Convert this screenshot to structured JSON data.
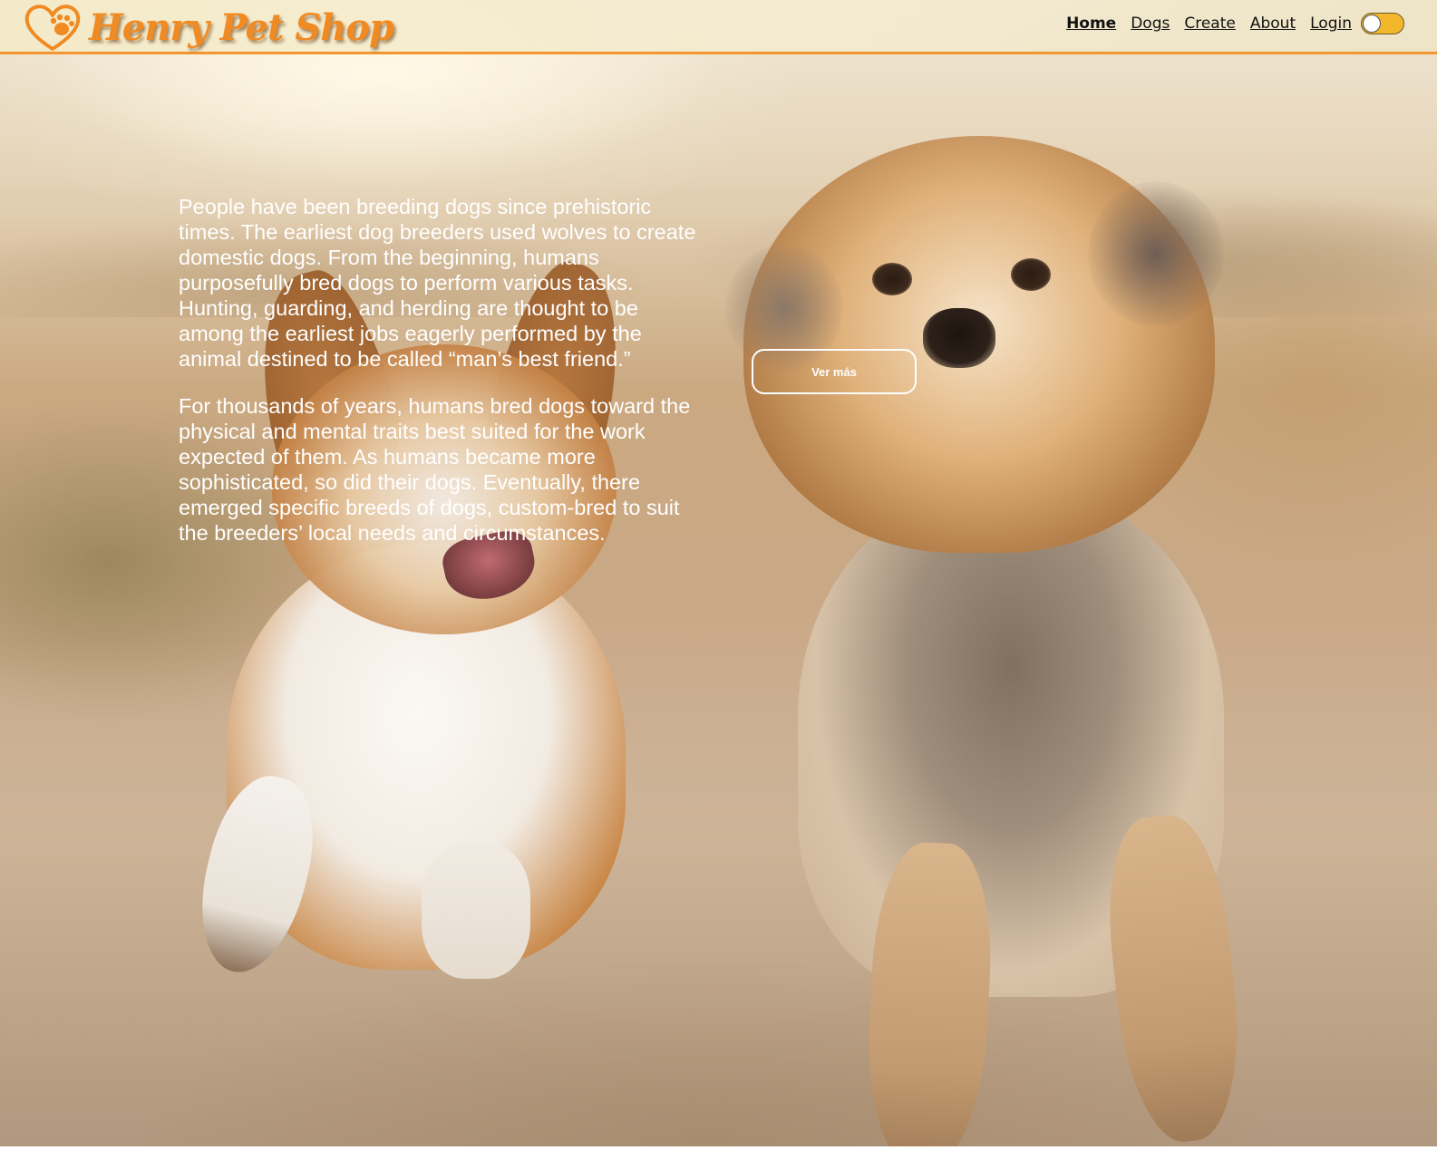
{
  "brand": {
    "name": "Henry Pet Shop",
    "logo_icon": "heart-paw-icon",
    "accent_color": "#f08a22"
  },
  "nav": {
    "links": [
      {
        "label": "Home",
        "active": true
      },
      {
        "label": "Dogs"
      },
      {
        "label": "Create"
      },
      {
        "label": "About"
      },
      {
        "label": "Login"
      }
    ],
    "theme_toggle": {
      "state": "off",
      "color": "#f2b72a"
    }
  },
  "hero": {
    "paragraphs": [
      "People have been breeding dogs since prehistoric times. The earliest dog breeders used wolves to create domestic dogs. From the beginning, humans purposefully bred dogs to perform various tasks. Hunting, guarding, and herding are thought to be among the earliest jobs eagerly performed by the animal destined to be called “man’s best friend.”",
      "For thousands of years, humans bred dogs toward the physical and mental traits best suited for the work expected of them. As humans became more sophisticated, so did their dogs. Eventually, there emerged specific breeds of dogs, custom-bred to suit the breeders’ local needs and circumstances."
    ],
    "cta_label": "Ver más"
  }
}
